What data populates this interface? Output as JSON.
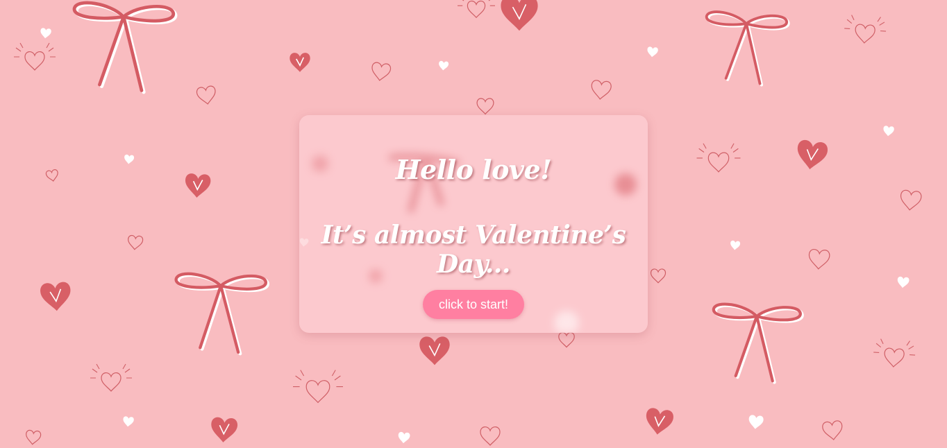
{
  "colors": {
    "background": "#f9bcc0",
    "heart_fill": "#d85f66",
    "heart_line": "#cf5f66",
    "heart_white": "#ffffff",
    "ribbon": "#d45b63",
    "card": "#fcced2",
    "button": "#ff7fa1",
    "text": "#ffffff"
  },
  "card": {
    "line1": "Hello love!",
    "line2": "It’s almost Valentine’s Day...",
    "button_label": "click to start!"
  }
}
